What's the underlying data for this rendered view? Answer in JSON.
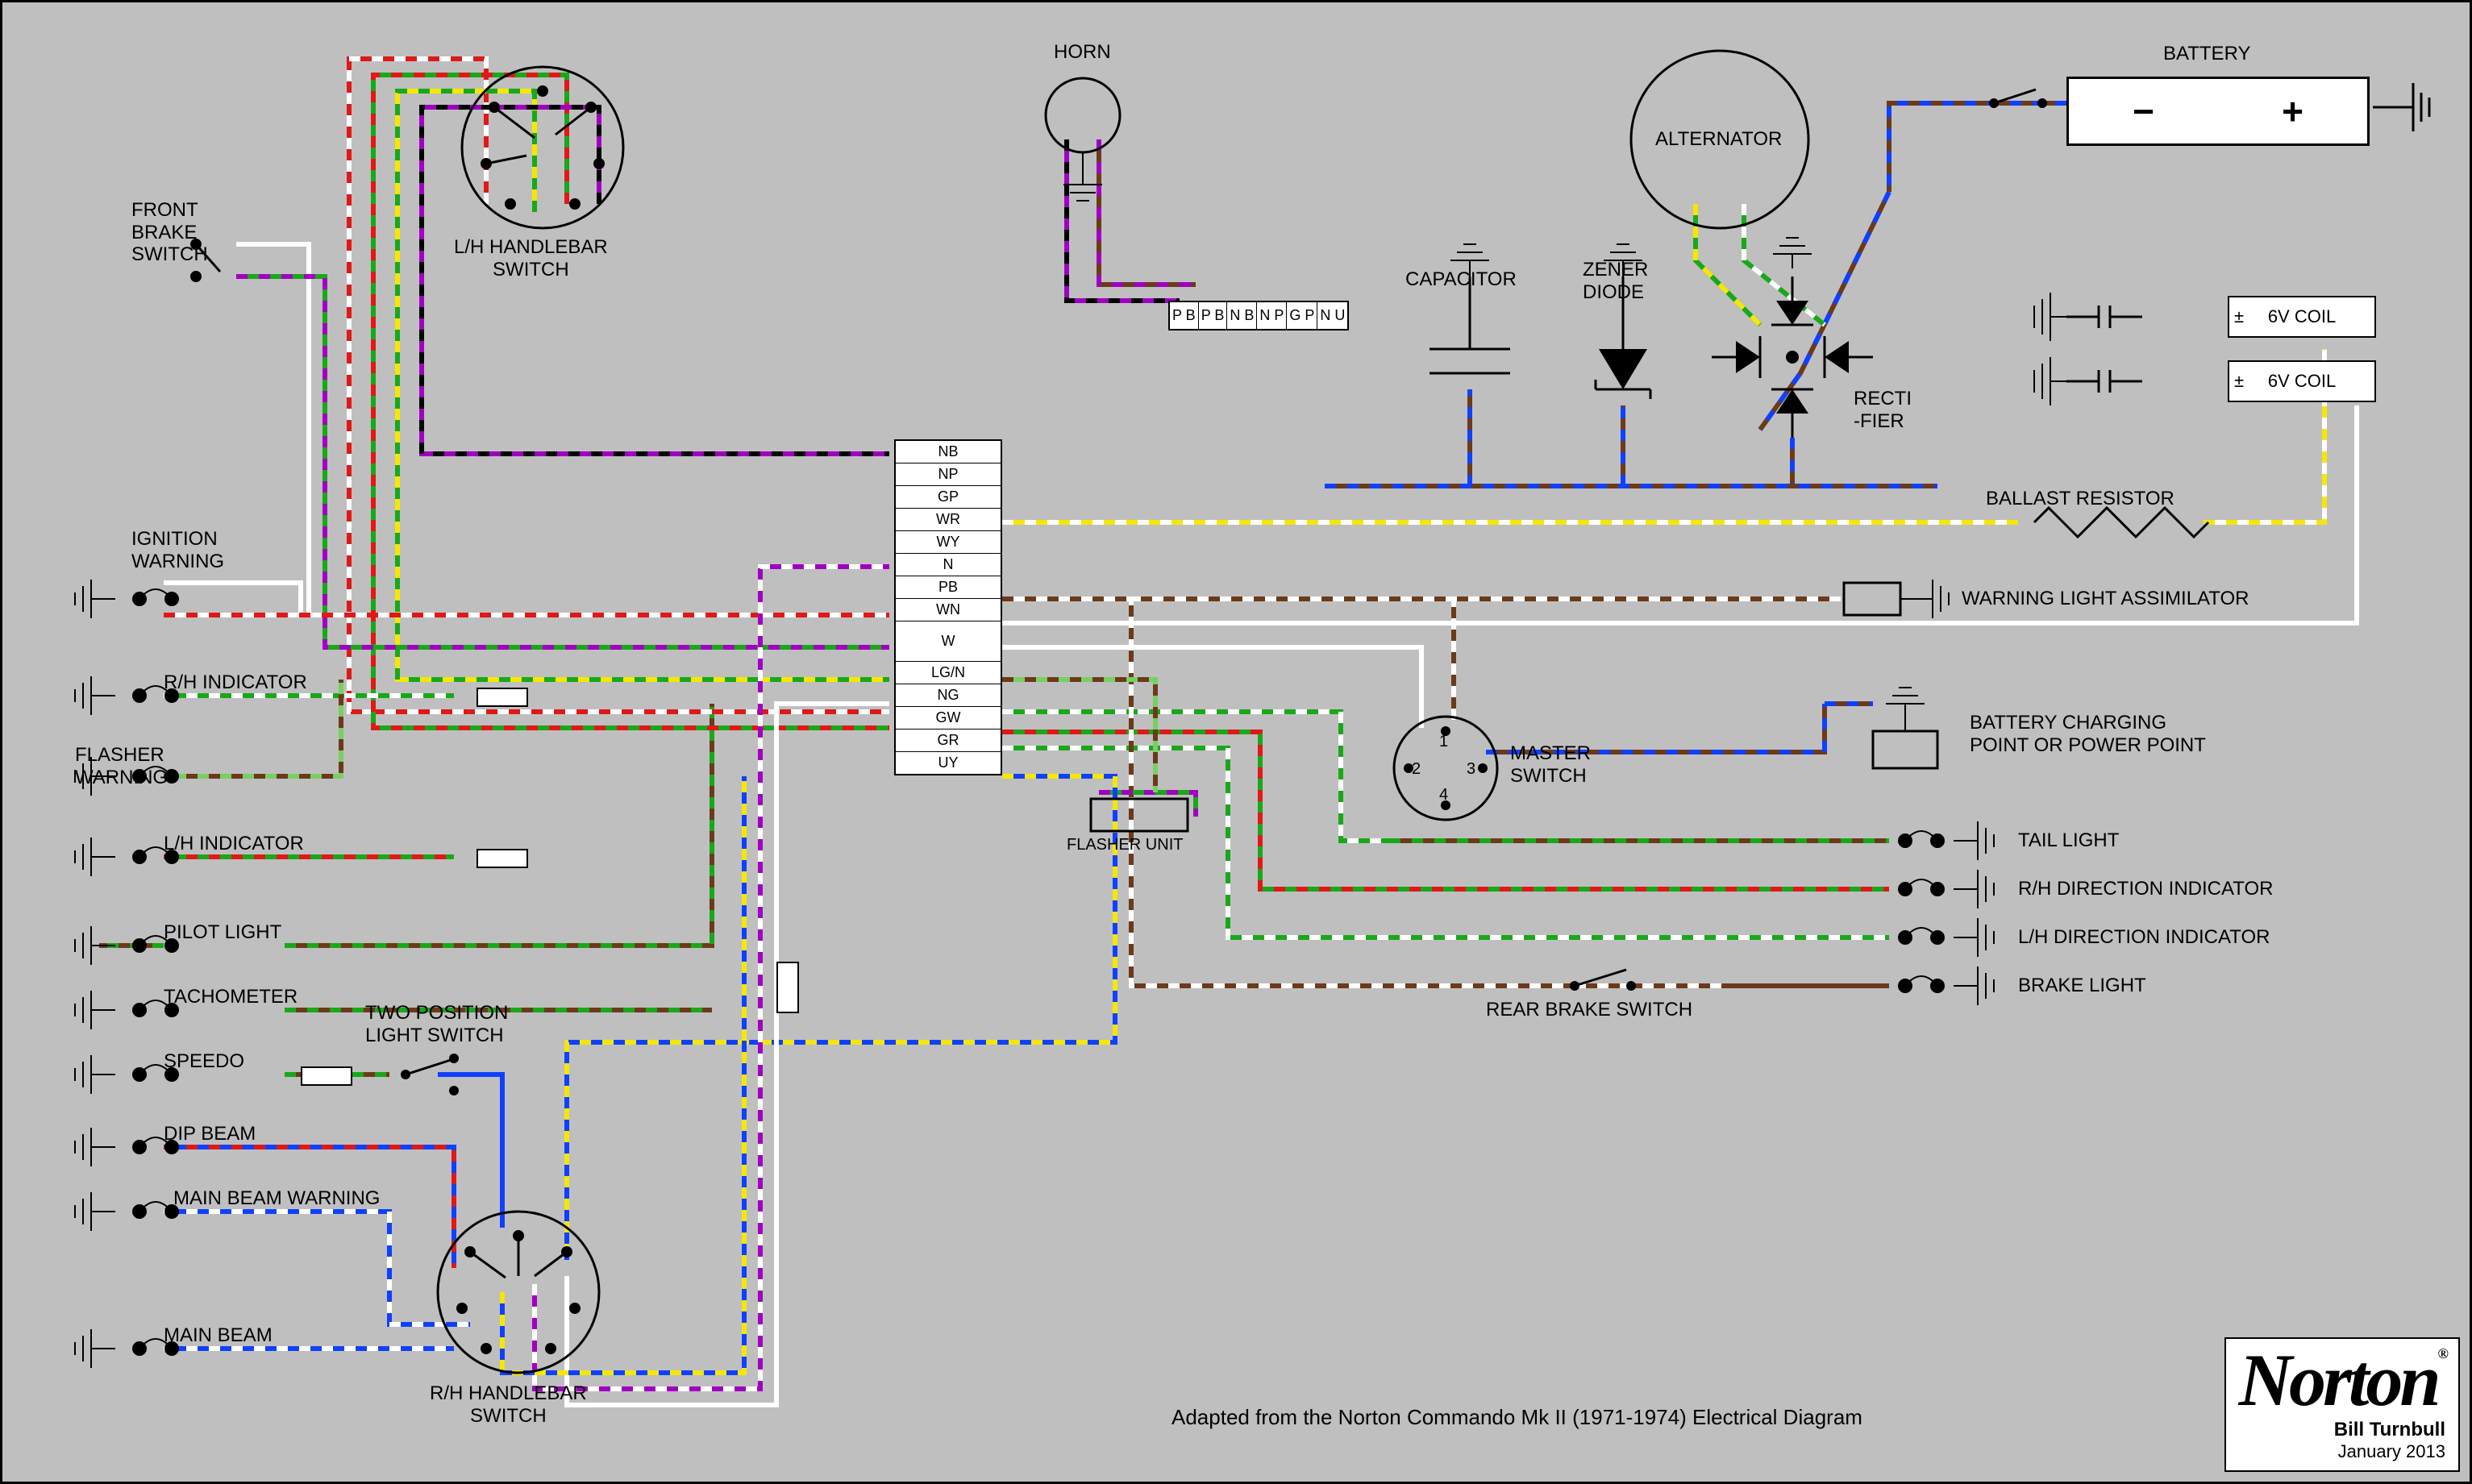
{
  "labels": {
    "horn": "HORN",
    "battery": "BATTERY",
    "alternator": "ALTERNATOR",
    "capacitor": "CAPACITOR",
    "zener": "ZENER\nDIODE",
    "rectifier": "RECTI\n-FIER",
    "coil1": "6V COIL",
    "coil2": "6V COIL",
    "ballast": "BALLAST RESISTOR",
    "wla": "WARNING LIGHT ASSIMILATOR",
    "charging": "BATTERY CHARGING\nPOINT OR POWER POINT",
    "master": "MASTER\nSWITCH",
    "flasher_unit": "FLASHER UNIT",
    "rear_brake": "REAR BRAKE SWITCH",
    "lh_handlebar": "L/H HANDLEBAR\nSWITCH",
    "rh_handlebar": "R/H HANDLEBAR\nSWITCH",
    "two_pos": "TWO POSITION\nLIGHT SWITCH",
    "front_brake": "FRONT\nBRAKE\nSWITCH",
    "ignition_warn": "IGNITION\nWARNING",
    "rh_ind": "R/H INDICATOR",
    "flasher_warn": "FLASHER\nWARNING",
    "lh_ind": "L/H INDICATOR",
    "pilot": "PILOT LIGHT",
    "tach": "TACHOMETER",
    "speedo": "SPEEDO",
    "dip": "DIP BEAM",
    "main_warn": "MAIN BEAM WARNING",
    "main_beam": "MAIN BEAM",
    "tail": "TAIL LIGHT",
    "rh_dir": "R/H DIRECTION INDICATOR",
    "lh_dir": "L/H DIRECTION INDICATOR",
    "brake_light": "BRAKE LIGHT"
  },
  "connector_main": [
    "NB",
    "NP",
    "GP",
    "WR",
    "WY",
    "N",
    "PB",
    "WN",
    "W",
    "LG/N",
    "NG",
    "GW",
    "GR",
    "UY"
  ],
  "connector_top": [
    "P B",
    "P B",
    "N B",
    "N P",
    "G P",
    "N U"
  ],
  "master_terminals": [
    "1",
    "2",
    "3",
    "4"
  ],
  "battery_terminals": {
    "neg": "−",
    "pos": "+"
  },
  "coil_polarity": "±",
  "credit": "Adapted from the Norton Commando Mk II (1971-1974) Electrical Diagram",
  "brand": "Norton",
  "brand_reg": "®",
  "author": "Bill Turnbull",
  "date": "January 2013",
  "wire_colors": {
    "NB": "brown/blue",
    "NP": "brown/purple",
    "GP": "green/purple",
    "WR": "white/red",
    "WY": "white/yellow",
    "N": "brown",
    "PB": "purple/black",
    "WN": "white/brown",
    "W": "white",
    "LGN": "light-green/brown",
    "NG": "brown/green",
    "GW": "green/white",
    "GR": "green/red",
    "UY": "blue/yellow",
    "NU": "brown/blue",
    "UW": "blue/white",
    "U": "blue"
  }
}
